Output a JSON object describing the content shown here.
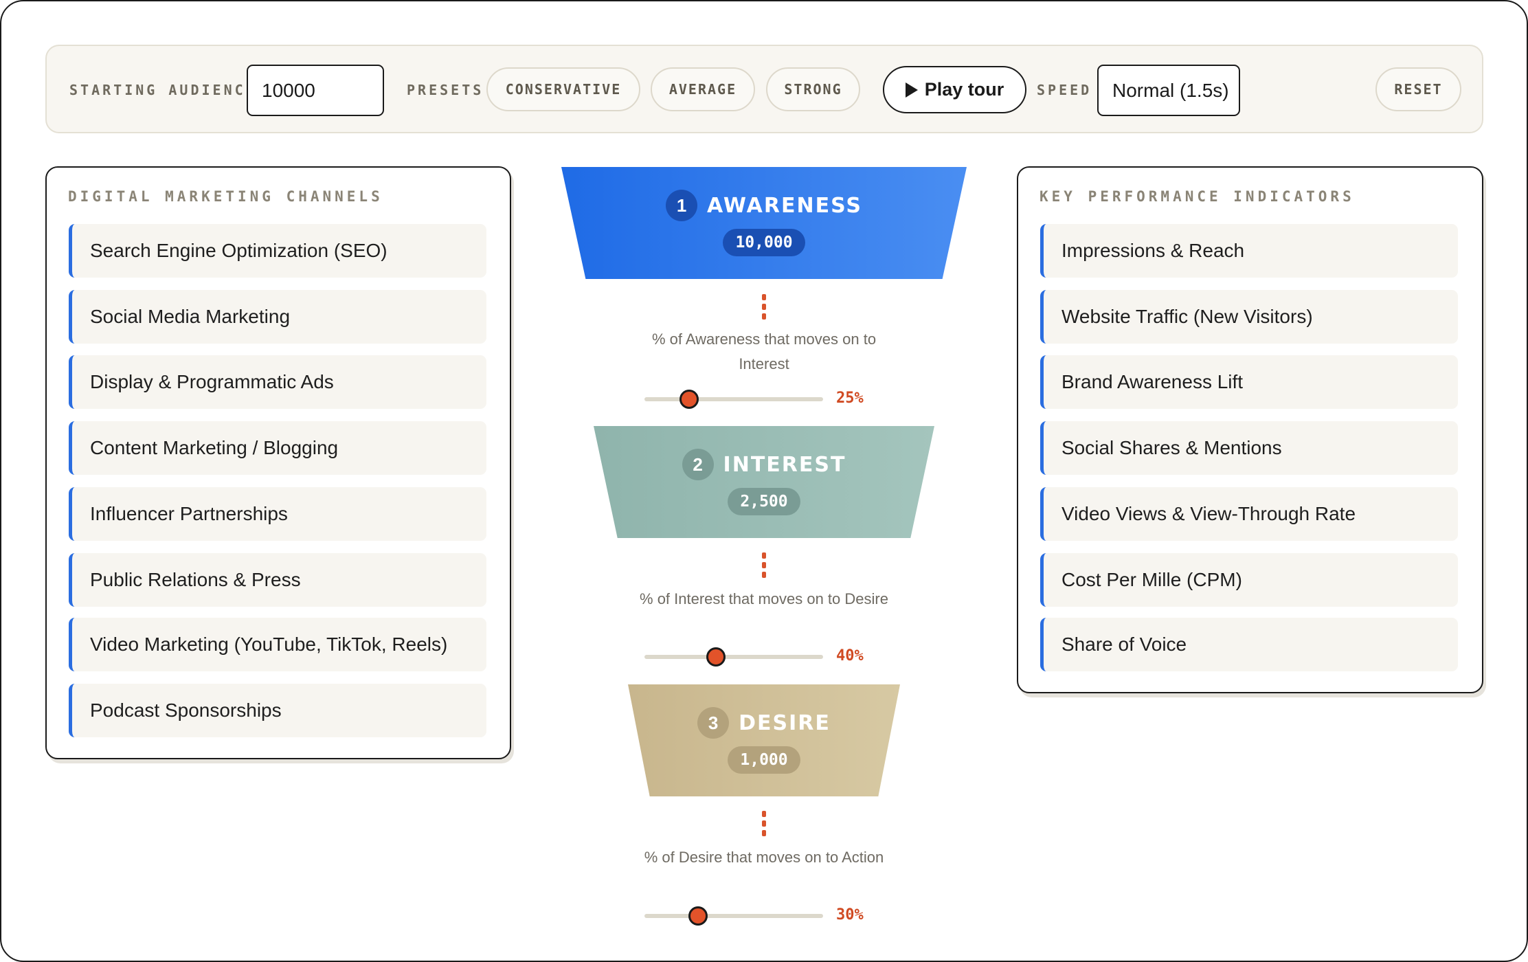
{
  "toolbar": {
    "starting_audience_label": "STARTING AUDIENCE",
    "starting_audience_value": "10000",
    "presets_label": "PRESETS",
    "presets": [
      "CONSERVATIVE",
      "AVERAGE",
      "STRONG"
    ],
    "play_label": "Play tour",
    "speed_label": "SPEED",
    "speed_value": "Normal (1.5s)",
    "reset_label": "RESET"
  },
  "channels": {
    "title": "DIGITAL MARKETING CHANNELS",
    "items": [
      "Search Engine Optimization (SEO)",
      "Social Media Marketing",
      "Display & Programmatic Ads",
      "Content Marketing / Blogging",
      "Influencer Partnerships",
      "Public Relations & Press",
      "Video Marketing (YouTube, TikTok, Reels)",
      "Podcast Sponsorships"
    ]
  },
  "kpis": {
    "title": "KEY PERFORMANCE INDICATORS",
    "items": [
      "Impressions & Reach",
      "Website Traffic (New Visitors)",
      "Brand Awareness Lift",
      "Social Shares & Mentions",
      "Video Views & View-Through Rate",
      "Cost Per Mille (CPM)",
      "Share of Voice"
    ]
  },
  "funnel": {
    "stages": [
      {
        "num": "1",
        "name": "AWARENESS",
        "count": "10,000",
        "color_start": "#1f6be6",
        "color_end": "#4a8ef2"
      },
      {
        "num": "2",
        "name": "INTEREST",
        "count": "2,500",
        "color_start": "#8fb4ac",
        "color_end": "#a4c5bd"
      },
      {
        "num": "3",
        "name": "DESIRE",
        "count": "1,000",
        "color_start": "#c8b68d",
        "color_end": "#d7c9a3"
      }
    ],
    "conversions": [
      {
        "label": "% of Awareness that moves on to Interest",
        "percent": "25%",
        "fraction": 0.25
      },
      {
        "label": "% of Interest that moves on to Desire",
        "percent": "40%",
        "fraction": 0.4
      },
      {
        "label": "% of Desire that moves on to Action",
        "percent": "30%",
        "fraction": 0.3
      }
    ]
  },
  "colors": {
    "accent_blue": "#2a6de0",
    "accent_orange": "#e2532a"
  }
}
